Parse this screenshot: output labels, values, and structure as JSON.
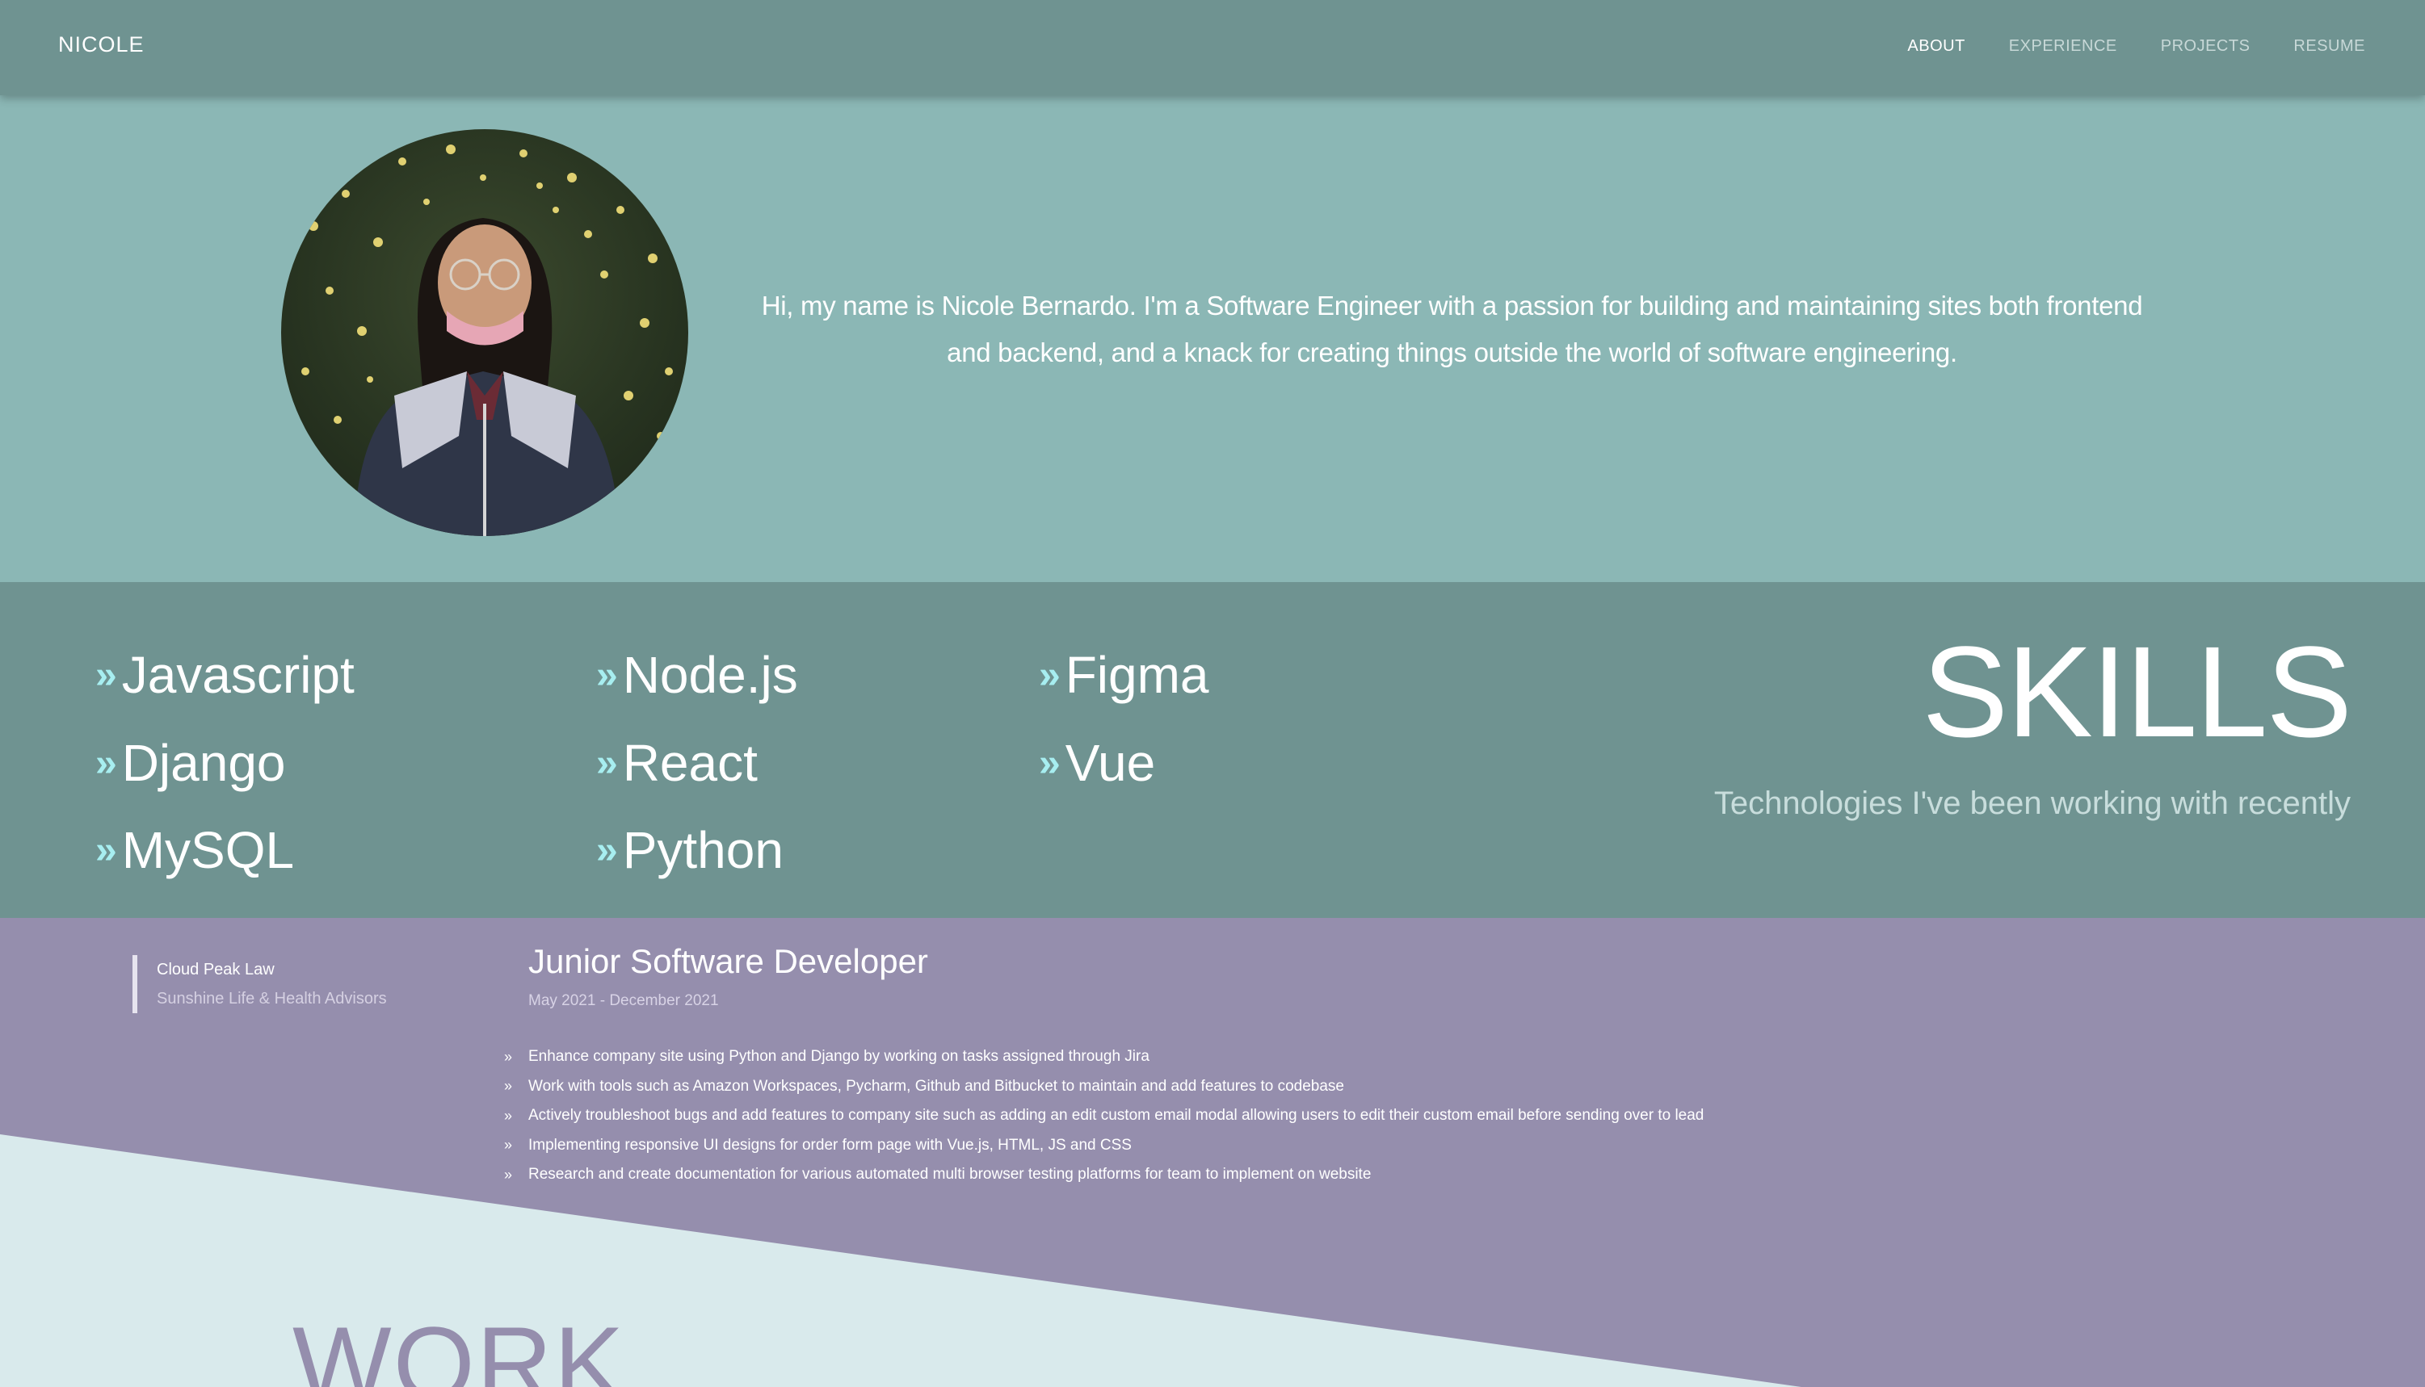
{
  "navbar": {
    "brand": "NICOLE",
    "links": [
      "ABOUT",
      "EXPERIENCE",
      "PROJECTS",
      "RESUME"
    ]
  },
  "about": {
    "bio": "Hi, my name is Nicole Bernardo. I'm a Software Engineer with a passion for building and maintaining sites both frontend and backend, and a knack for creating things outside the world of software engineering."
  },
  "skills": {
    "title": "SKILLS",
    "subtitle": "Technologies I've been working with recently",
    "items": [
      "Javascript",
      "Node.js",
      "Figma",
      "Django",
      "React",
      "Vue",
      "MySQL",
      "Python"
    ]
  },
  "experience": {
    "companies": [
      "Cloud Peak Law",
      "Sunshine Life & Health Advisors"
    ],
    "job_title": "Junior Software Developer",
    "dates": "May 2021 - December 2021",
    "bullets": [
      "Enhance company site using Python and Django by working on tasks assigned through Jira",
      "Work with tools such as Amazon Workspaces, Pycharm, Github and Bitbucket to maintain and add features to codebase",
      "Actively troubleshoot bugs and add features to company site such as adding an edit custom email modal allowing users to edit their custom email before sending over to lead",
      "Implementing responsive UI designs for order form page with Vue.js, HTML, JS and CSS",
      "Research and create documentation for various automated multi browser testing platforms for team to implement on website"
    ],
    "section_title": "WORK"
  },
  "colors": {
    "nav_bg": "#6f9391",
    "about_bg": "#8bb7b5",
    "skills_bg": "#6f9391",
    "experience_bg": "#958ead",
    "accent": "#a7eef0"
  }
}
